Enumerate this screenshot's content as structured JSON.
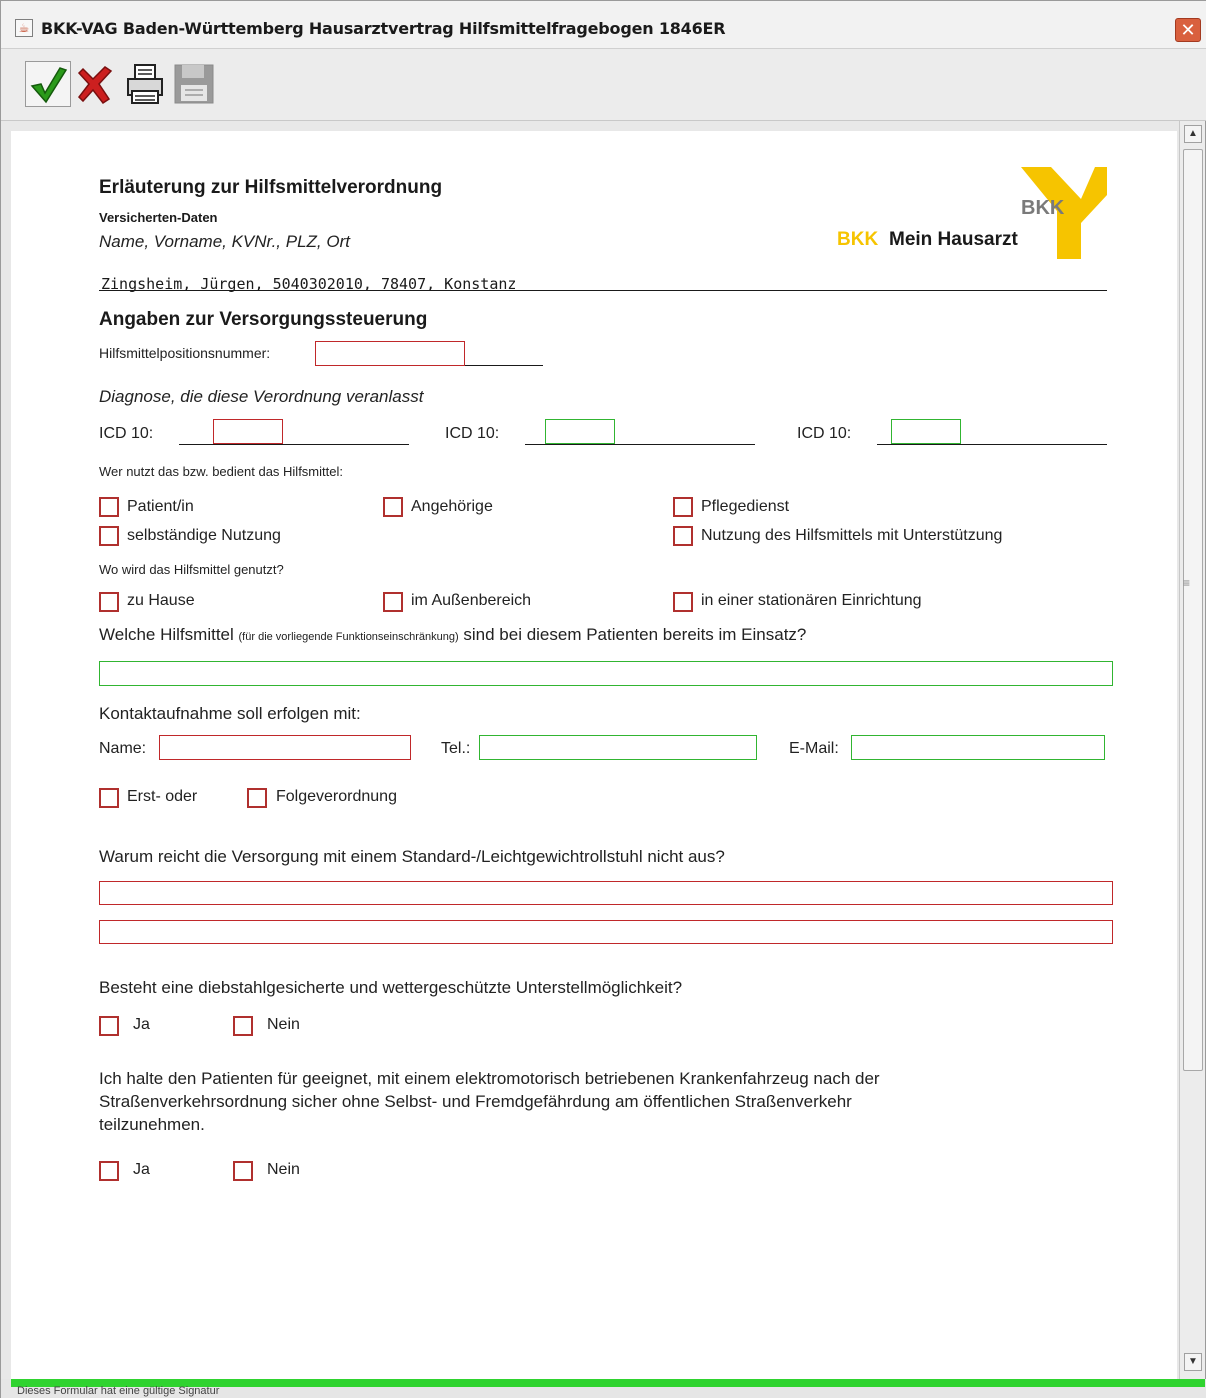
{
  "window": {
    "title": "BKK-VAG Baden-Württemberg Hausarztvertrag  Hilfsmittelfragebogen 1846ER",
    "close_label": "✕"
  },
  "toolbar": {
    "ok_icon": "check-icon",
    "cancel_icon": "cancel-x-icon",
    "print_icon": "printer-icon",
    "save_icon": "floppy-icon"
  },
  "logo": {
    "bkk": "BKK",
    "line_left": "BKK",
    "line_right": "Mein Hausarzt",
    "brand_yellow": "#f6c400"
  },
  "form": {
    "title": "Erläuterung zur Hilfsmittelverordnung",
    "insured_label": "Versicherten-Daten",
    "insured_hint": "Name, Vorname, KVNr., PLZ, Ort",
    "insured_value": "Zingsheim, Jürgen, 5040302010, 78407, Konstanz",
    "section_title": "Angaben zur Versorgungssteuerung",
    "position_label": "Hilfsmittelpositionsnummer:",
    "position_value": "",
    "diagnosis_title": "Diagnose, die diese Verordnung veranlasst",
    "icd_label": "ICD 10:",
    "icd_values": [
      "",
      "",
      ""
    ],
    "who_title": "Wer nutzt das bzw. bedient das Hilfsmittel:",
    "who_options": [
      "Patient/in",
      "Angehörige",
      "Pflegedienst",
      "selbständige Nutzung",
      "Nutzung des Hilfsmittels mit Unterstützung"
    ],
    "where_title": "Wo wird das Hilfsmittel genutzt?",
    "where_options": [
      "zu Hause",
      "im Außenbereich",
      "in einer stationären Einrichtung"
    ],
    "aids_q_a": "Welche Hilfsmittel",
    "aids_q_b": "(für die vorliegende Funktionseinschränkung)",
    "aids_q_c": "sind bei diesem Patienten bereits im Einsatz?",
    "aids_value": "",
    "contact_title": "Kontaktaufnahme soll erfolgen mit:",
    "contact_name_label": "Name:",
    "contact_tel_label": "Tel.:",
    "contact_mail_label": "E-Mail:",
    "contact_name_value": "",
    "contact_tel_value": "",
    "contact_mail_value": "",
    "order_options": [
      "Erst- oder",
      "Folgeverordnung"
    ],
    "why_q": "Warum reicht die Versorgung mit einem Standard-/Leichtgewichtrollstuhl nicht aus?",
    "why_value_1": "",
    "why_value_2": "",
    "shelter_q": "Besteht eine diebstahlgesicherte und wettergeschützte Unterstellmöglichkeit?",
    "yes": "Ja",
    "no": "Nein",
    "fit_q_1": "Ich halte den Patienten für geeignet, mit einem elektromotorisch betriebenen Krankenfahrzeug nach der",
    "fit_q_2": "Straßenverkehrsordnung sicher ohne Selbst- und Fremdgefährdung am öffentlichen Straßenverkehr",
    "fit_q_3": "teilzunehmen."
  },
  "status": {
    "text": "Dieses Formular hat eine gültige Signatur",
    "bar_color": "#2fd32f"
  }
}
